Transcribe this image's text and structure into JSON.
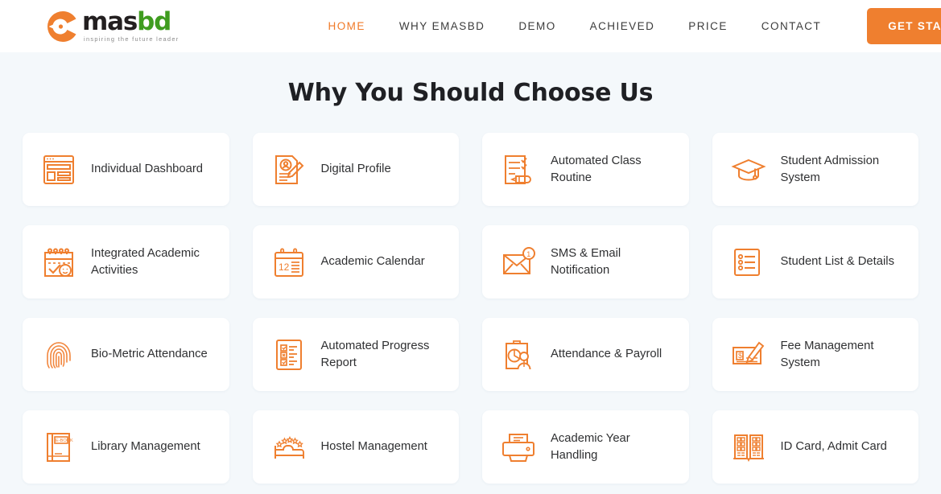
{
  "brand": {
    "name_dark": "mas",
    "name_green": "bd",
    "tagline": "inspiring the future leader",
    "logo_icon": "emasbd-c-mark-icon",
    "accent_color": "#ef7f2f",
    "green_color": "#3f9c1f"
  },
  "nav": {
    "items": [
      {
        "label": "HOME",
        "active": true
      },
      {
        "label": "WHY EMASBD",
        "active": false
      },
      {
        "label": "DEMO",
        "active": false
      },
      {
        "label": "ACHIEVED",
        "active": false
      },
      {
        "label": "PRICE",
        "active": false
      },
      {
        "label": "CONTACT",
        "active": false
      }
    ],
    "cta_label": "GET STARTED"
  },
  "main": {
    "title": "Why You Should Choose Us",
    "background_color": "#f4f8fb",
    "card_background": "#ffffff",
    "features": [
      {
        "label": "Individual Dashboard",
        "icon": "dashboard-layout-icon"
      },
      {
        "label": "Digital Profile",
        "icon": "profile-document-pencil-icon"
      },
      {
        "label": "Automated Class Routine",
        "icon": "checklist-pencil-icon"
      },
      {
        "label": "Student Admission System",
        "icon": "graduation-cap-icon"
      },
      {
        "label": "Integrated Academic Activities",
        "icon": "calendar-check-clock-icon"
      },
      {
        "label": "Academic Calendar",
        "icon": "calendar-12-lines-icon"
      },
      {
        "label": "SMS & Email Notification",
        "icon": "envelope-notification-icon"
      },
      {
        "label": "Student List & Details",
        "icon": "list-document-icon"
      },
      {
        "label": "Bio-Metric Attendance",
        "icon": "fingerprint-icon"
      },
      {
        "label": "Automated Progress Report",
        "icon": "report-checklist-icon"
      },
      {
        "label": "Attendance & Payroll",
        "icon": "clipboard-person-chart-icon"
      },
      {
        "label": "Fee Management System",
        "icon": "cheque-pencil-icon"
      },
      {
        "label": "Library Management",
        "icon": "ebook-icon"
      },
      {
        "label": "Hostel Management",
        "icon": "bed-stars-icon"
      },
      {
        "label": "Academic Year Handling",
        "icon": "printer-icon"
      },
      {
        "label": "ID Card, Admit Card",
        "icon": "open-book-cards-icon"
      }
    ]
  }
}
